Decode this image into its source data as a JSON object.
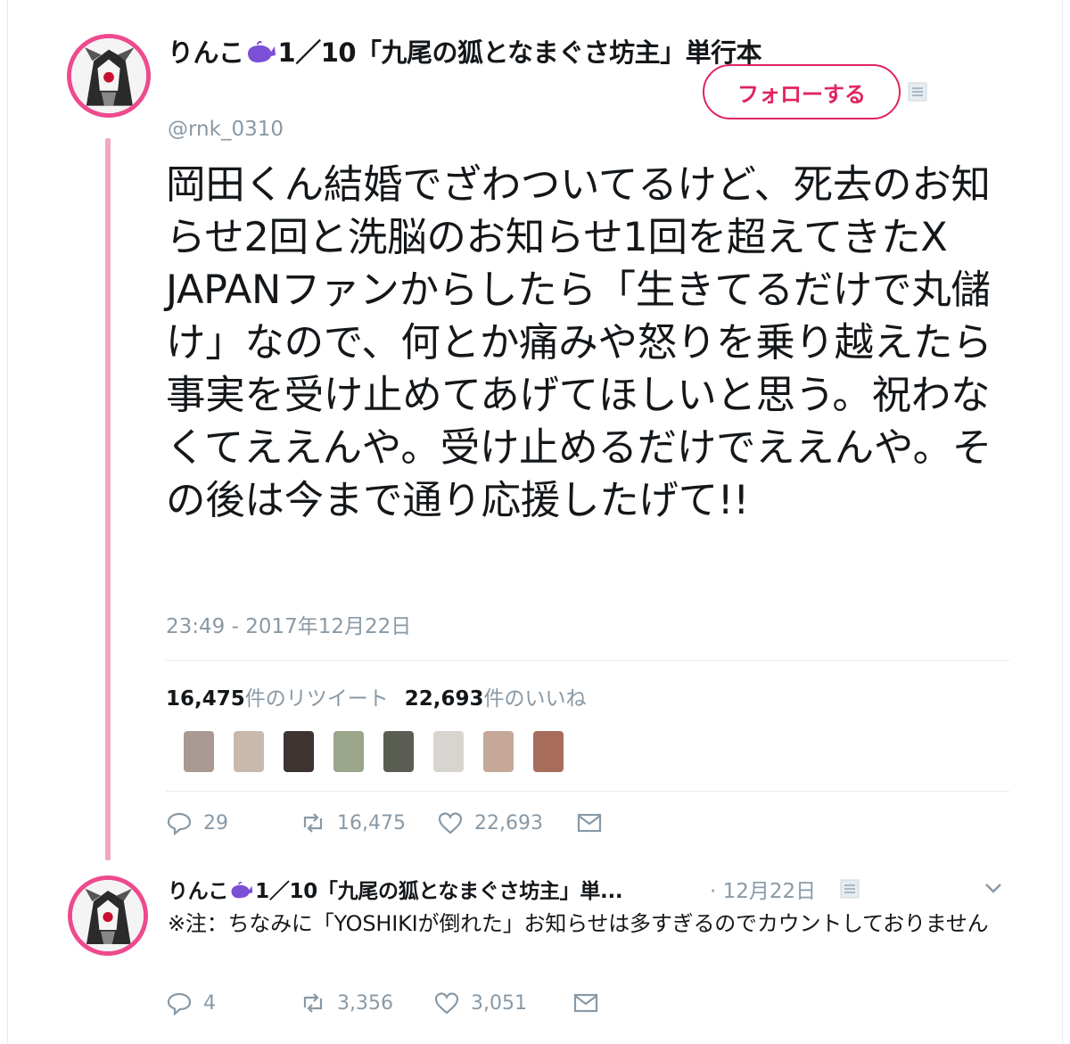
{
  "tweet": {
    "display_name_before_icon": "りんこ",
    "display_name_after_icon": "1／10「九尾の狐となまぐさ坊主」単行本",
    "name_icon": "whale-icon",
    "handle": "@rnk_0310",
    "follow_label": "フォローする",
    "text": "岡田くん結婚でざわついてるけど、死去のお知らせ2回と洗脳のお知らせ1回を超えてきたX JAPANファンからしたら「生きてるだけで丸儲け」なので、何とか痛みや怒りを乗り越えたら事実を受け止めてあげてほしいと思う。祝わなくてええんや。受け止めるだけでええんや。その後は今まで通り応援したげて!!",
    "timestamp": "23:49 - 2017年12月22日",
    "retweet_count": "16,475",
    "retweet_label": "件のリツイート",
    "like_count": "22,693",
    "like_label": "件のいいね",
    "actions": {
      "replies": "29",
      "retweets": "16,475",
      "likes": "22,693"
    }
  },
  "reply": {
    "display_name_before_icon": "りんこ",
    "display_name_after_icon": "1／10「九尾の狐となまぐさ坊主」単...",
    "date": "· 12月22日",
    "text": "※注：ちなみに「YOSHIKIが倒れた」お知らせは多すぎるのでカウントしておりません",
    "actions": {
      "replies": "4",
      "retweets": "3,356",
      "likes": "3,051"
    }
  },
  "colors": {
    "accent": "#e0245e",
    "avatar_ring": "#ee4a8e",
    "thread_line": "#f2a7c3",
    "muted": "#8899a6",
    "whale": "#7b4fd6"
  }
}
